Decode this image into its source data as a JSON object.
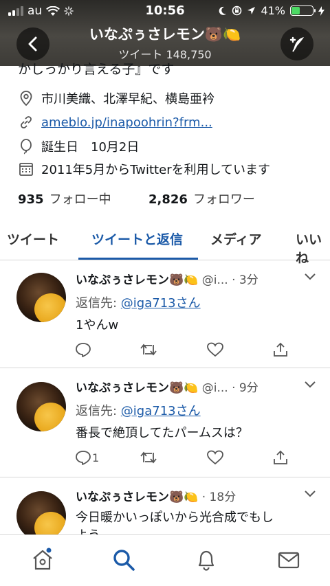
{
  "status_bar": {
    "carrier": "au",
    "time": "10:56",
    "battery": "41%",
    "battery_level": 0.41
  },
  "header": {
    "title": "いなぷぅさレモン🐻🍋",
    "subtitle": "ツイート 148,750"
  },
  "profile": {
    "bio_fragment": "かしっかり言える子』です",
    "members": "市川美織、北澤早紀、横島亜衿",
    "url": "ameblo.jp/inapoohrin?frm...",
    "birthday": "誕生日　10月2日",
    "joined": "2011年5月からTwitterを利用しています",
    "following_count": "935",
    "following_label": "フォロー中",
    "followers_count": "2,826",
    "followers_label": "フォロワー"
  },
  "tabs": [
    {
      "label": "ツイート"
    },
    {
      "label": "ツイートと返信"
    },
    {
      "label": "メディア"
    },
    {
      "label": "いいね"
    }
  ],
  "tweets": [
    {
      "name": "いなぷぅさレモン🐻🍋",
      "handle": "@i...",
      "time": "· 3分",
      "reply_prefix": "返信先: ",
      "reply_to": "@iga713さん",
      "text": "1やんw",
      "reply_count": ""
    },
    {
      "name": "いなぷぅさレモン🐻🍋",
      "handle": "@i...",
      "time": "· 9分",
      "reply_prefix": "返信先: ",
      "reply_to": "@iga713さん",
      "text": "番長で絶頂してたパームスは？",
      "reply_count": "1"
    },
    {
      "name": "いなぷぅさレモン🐻🍋",
      "handle": "",
      "time": "· 18分",
      "text": "今日暖かいっぽいから光合成でもし",
      "text2": "よう"
    }
  ],
  "colors": {
    "accent": "#1b5aa8",
    "text": "#14171a",
    "muted": "#555555",
    "battery": "#4cd964"
  }
}
